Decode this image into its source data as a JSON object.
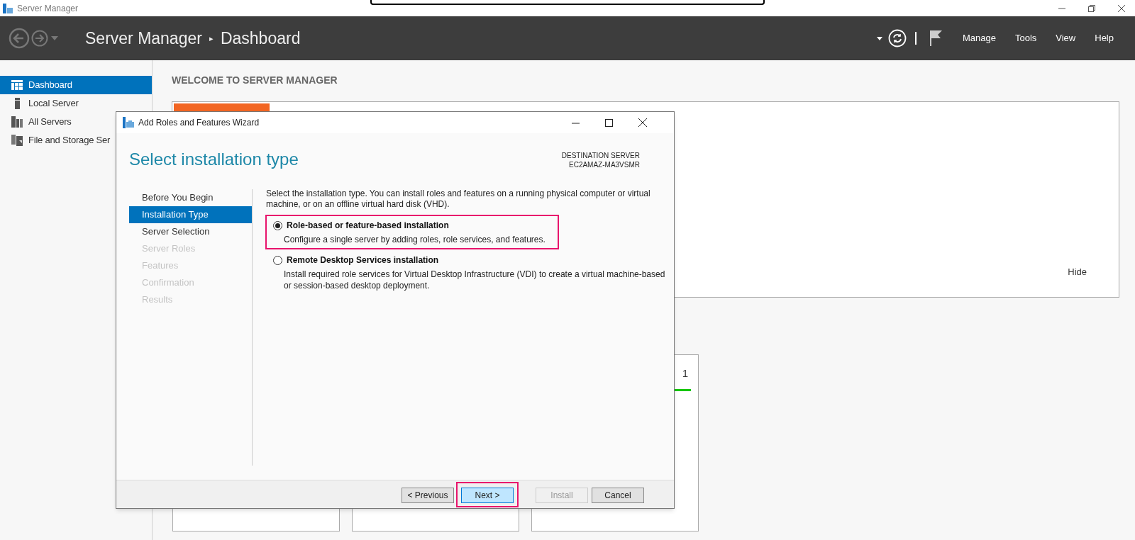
{
  "window": {
    "title": "Server Manager"
  },
  "header": {
    "breadcrumb_root": "Server Manager",
    "breadcrumb_separator": "▸",
    "breadcrumb_page": "Dashboard",
    "menu": [
      "Manage",
      "Tools",
      "View",
      "Help"
    ]
  },
  "sidebar": {
    "items": [
      {
        "label": "Dashboard",
        "kind": "dashboard",
        "selected": true
      },
      {
        "label": "Local Server",
        "kind": "server",
        "selected": false
      },
      {
        "label": "All Servers",
        "kind": "servers",
        "selected": false
      },
      {
        "label": "File and Storage Ser",
        "kind": "storage",
        "selected": false
      }
    ]
  },
  "welcome": {
    "heading": "WELCOME TO SERVER MANAGER",
    "hide_link": "Hide"
  },
  "tiles": [
    {
      "kind": "blank"
    },
    {
      "kind": "blank"
    },
    {
      "kind": "count",
      "count": "1"
    }
  ],
  "wizard": {
    "title": "Add Roles and Features Wizard",
    "page_title": "Select installation type",
    "destination_label": "DESTINATION SERVER",
    "destination_server": "EC2AMAZ-MA3VSMR",
    "steps": [
      {
        "label": "Before You Begin",
        "selected": false,
        "enabled": true
      },
      {
        "label": "Installation Type",
        "selected": true,
        "enabled": true
      },
      {
        "label": "Server Selection",
        "selected": false,
        "enabled": true
      },
      {
        "label": "Server Roles",
        "selected": false,
        "enabled": false
      },
      {
        "label": "Features",
        "selected": false,
        "enabled": false
      },
      {
        "label": "Confirmation",
        "selected": false,
        "enabled": false
      },
      {
        "label": "Results",
        "selected": false,
        "enabled": false
      }
    ],
    "intro": "Select the installation type. You can install roles and features on a running physical computer or virtual machine, or on an offline virtual hard disk (VHD).",
    "options": [
      {
        "label": "Role-based or feature-based installation",
        "description": "Configure a single server by adding roles, role services, and features.",
        "selected": true,
        "highlighted": true
      },
      {
        "label": "Remote Desktop Services installation",
        "description": "Install required role services for Virtual Desktop Infrastructure (VDI) to create a virtual machine-based or session-based desktop deployment.",
        "selected": false,
        "highlighted": false
      }
    ],
    "buttons": [
      {
        "label": "< Previous",
        "disabled": false,
        "default": false,
        "highlighted": false
      },
      {
        "label": "Next >",
        "disabled": false,
        "default": true,
        "highlighted": true
      },
      {
        "label": "Install",
        "disabled": true,
        "default": false,
        "highlighted": false
      },
      {
        "label": "Cancel",
        "disabled": false,
        "default": false,
        "highlighted": false
      }
    ]
  }
}
